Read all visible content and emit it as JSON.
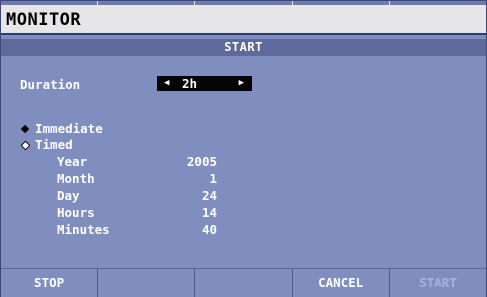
{
  "window": {
    "title": "MONITOR"
  },
  "section": {
    "title": "START"
  },
  "duration": {
    "label": "Duration",
    "value": "2h"
  },
  "start_mode": {
    "options": [
      {
        "label": "Immediate",
        "selected": true
      },
      {
        "label": "Timed",
        "selected": false
      }
    ]
  },
  "timed_params": [
    {
      "name": "Year",
      "value": "2005"
    },
    {
      "name": "Month",
      "value": "1"
    },
    {
      "name": "Day",
      "value": "24"
    },
    {
      "name": "Hours",
      "value": "14"
    },
    {
      "name": "Minutes",
      "value": "40"
    }
  ],
  "softkeys": [
    {
      "label": "STOP",
      "enabled": true
    },
    {
      "label": "",
      "enabled": true
    },
    {
      "label": "",
      "enabled": true
    },
    {
      "label": "CANCEL",
      "enabled": true
    },
    {
      "label": "START",
      "enabled": false
    }
  ],
  "colors": {
    "background": "#7f8ebf",
    "section_bar": "#5d6a9b",
    "title_bar": "#e6e6e8",
    "selector_box": "#050505"
  }
}
